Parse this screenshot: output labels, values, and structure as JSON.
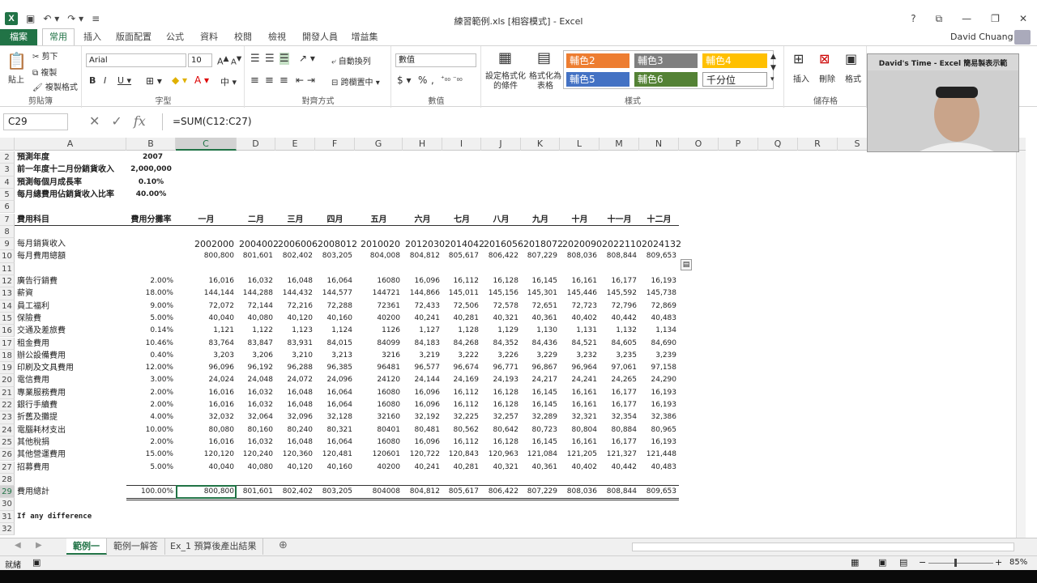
{
  "window": {
    "title": "練習範例.xls  [相容模式] - Excel"
  },
  "ribbon_tabs": [
    {
      "label": "檔案"
    },
    {
      "label": "常用"
    },
    {
      "label": "插入"
    },
    {
      "label": "版面配置"
    },
    {
      "label": "公式"
    },
    {
      "label": "資料"
    },
    {
      "label": "校閱"
    },
    {
      "label": "檢視"
    },
    {
      "label": "開發人員"
    },
    {
      "label": "增益集"
    }
  ],
  "user": {
    "name": "David Chuang"
  },
  "ribbon": {
    "clipboard": {
      "label": "剪貼簿",
      "paste": "貼上",
      "cut": "剪下",
      "copy": "複製",
      "format_painter": "複製格式"
    },
    "font": {
      "label": "字型",
      "name": "Arial",
      "size": "10"
    },
    "alignment": {
      "label": "對齊方式",
      "wrap": "自動換列",
      "merge": "跨欄置中"
    },
    "number": {
      "label": "數值",
      "format": "數值"
    },
    "styles": {
      "label": "樣式",
      "conditional": "設定格式化\n的條件",
      "table": "格式化為\n表格",
      "cells": [
        {
          "label": "輔色2",
          "color": "#ED7D31"
        },
        {
          "label": "輔色3",
          "color": "#7F7F7F"
        },
        {
          "label": "輔色4",
          "color": "#FFC000"
        },
        {
          "label": "輔色5",
          "color": "#4472C4"
        },
        {
          "label": "輔色6",
          "color": "#548235"
        },
        {
          "label": "千分位",
          "color": "#FFFFFF"
        }
      ]
    },
    "cells_group": {
      "label": "儲存格",
      "insert": "插入",
      "delete": "刪除",
      "format": "格式"
    }
  },
  "formula_bar": {
    "name_box": "C29",
    "formula": "=SUM(C12:C27)"
  },
  "webcam": {
    "title": "David's Time - Excel 簡易製表示範"
  },
  "columns": [
    "A",
    "B",
    "C",
    "D",
    "E",
    "F",
    "G",
    "H",
    "I",
    "J",
    "K",
    "L",
    "M",
    "N",
    "O",
    "P",
    "Q",
    "R",
    "S"
  ],
  "selected_column": "C",
  "selected_row": "29",
  "rows": [
    "2",
    "3",
    "4",
    "5",
    "6",
    "7",
    "8",
    "9",
    "10",
    "11",
    "12",
    "13",
    "14",
    "15",
    "16",
    "17",
    "18",
    "19",
    "20",
    "21",
    "22",
    "23",
    "24",
    "25",
    "26",
    "27",
    "28",
    "29",
    "30",
    "31",
    "32"
  ],
  "sheet": {
    "params": [
      {
        "label": "預測年度",
        "value": "2007"
      },
      {
        "label": "前一年度十二月份銷貨收入",
        "value": "2,000,000"
      },
      {
        "label": "預測每個月成長率",
        "value": "0.10%"
      },
      {
        "label": "每月總費用佔銷貨收入比率",
        "value": "40.00%"
      }
    ],
    "header": {
      "item": "費用科目",
      "ratio": "費用分攤率",
      "months": [
        "一月",
        "二月",
        "三月",
        "四月",
        "五月",
        "六月",
        "七月",
        "八月",
        "九月",
        "十月",
        "十一月",
        "十二月"
      ]
    },
    "sales": {
      "label": "每月銷貨收入",
      "values": [
        "2002000",
        "2004002",
        "2006006",
        "2008012",
        "2010020",
        "2012030",
        "2014042",
        "2016056",
        "2018072",
        "2020090",
        "2022110",
        "2024132"
      ]
    },
    "total_expense": {
      "label": "每月費用總額",
      "values": [
        "800,800",
        "801,601",
        "802,402",
        "803,205",
        "804,008",
        "804,812",
        "805,617",
        "806,422",
        "807,229",
        "808,036",
        "808,844",
        "809,653"
      ]
    },
    "expenses": [
      {
        "name": "廣告行銷費",
        "ratio": "2.00%",
        "values": [
          "16,016",
          "16,032",
          "16,048",
          "16,064",
          "16080",
          "16,096",
          "16,112",
          "16,128",
          "16,145",
          "16,161",
          "16,177",
          "16,193"
        ]
      },
      {
        "name": "薪資",
        "ratio": "18.00%",
        "values": [
          "144,144",
          "144,288",
          "144,432",
          "144,577",
          "144721",
          "144,866",
          "145,011",
          "145,156",
          "145,301",
          "145,446",
          "145,592",
          "145,738"
        ]
      },
      {
        "name": "員工福利",
        "ratio": "9.00%",
        "values": [
          "72,072",
          "72,144",
          "72,216",
          "72,288",
          "72361",
          "72,433",
          "72,506",
          "72,578",
          "72,651",
          "72,723",
          "72,796",
          "72,869"
        ]
      },
      {
        "name": "保險費",
        "ratio": "5.00%",
        "values": [
          "40,040",
          "40,080",
          "40,120",
          "40,160",
          "40200",
          "40,241",
          "40,281",
          "40,321",
          "40,361",
          "40,402",
          "40,442",
          "40,483"
        ]
      },
      {
        "name": "交通及差旅費",
        "ratio": "0.14%",
        "values": [
          "1,121",
          "1,122",
          "1,123",
          "1,124",
          "1126",
          "1,127",
          "1,128",
          "1,129",
          "1,130",
          "1,131",
          "1,132",
          "1,134"
        ]
      },
      {
        "name": "租金費用",
        "ratio": "10.46%",
        "values": [
          "83,764",
          "83,847",
          "83,931",
          "84,015",
          "84099",
          "84,183",
          "84,268",
          "84,352",
          "84,436",
          "84,521",
          "84,605",
          "84,690"
        ]
      },
      {
        "name": "辦公設備費用",
        "ratio": "0.40%",
        "values": [
          "3,203",
          "3,206",
          "3,210",
          "3,213",
          "3216",
          "3,219",
          "3,222",
          "3,226",
          "3,229",
          "3,232",
          "3,235",
          "3,239"
        ]
      },
      {
        "name": "印刷及文具費用",
        "ratio": "12.00%",
        "values": [
          "96,096",
          "96,192",
          "96,288",
          "96,385",
          "96481",
          "96,577",
          "96,674",
          "96,771",
          "96,867",
          "96,964",
          "97,061",
          "97,158"
        ]
      },
      {
        "name": "電信費用",
        "ratio": "3.00%",
        "values": [
          "24,024",
          "24,048",
          "24,072",
          "24,096",
          "24120",
          "24,144",
          "24,169",
          "24,193",
          "24,217",
          "24,241",
          "24,265",
          "24,290"
        ]
      },
      {
        "name": "專業服務費用",
        "ratio": "2.00%",
        "values": [
          "16,016",
          "16,032",
          "16,048",
          "16,064",
          "16080",
          "16,096",
          "16,112",
          "16,128",
          "16,145",
          "16,161",
          "16,177",
          "16,193"
        ]
      },
      {
        "name": "銀行手續費",
        "ratio": "2.00%",
        "values": [
          "16,016",
          "16,032",
          "16,048",
          "16,064",
          "16080",
          "16,096",
          "16,112",
          "16,128",
          "16,145",
          "16,161",
          "16,177",
          "16,193"
        ]
      },
      {
        "name": "折舊及攤提",
        "ratio": "4.00%",
        "values": [
          "32,032",
          "32,064",
          "32,096",
          "32,128",
          "32160",
          "32,192",
          "32,225",
          "32,257",
          "32,289",
          "32,321",
          "32,354",
          "32,386"
        ]
      },
      {
        "name": "電腦耗材支出",
        "ratio": "10.00%",
        "values": [
          "80,080",
          "80,160",
          "80,240",
          "80,321",
          "80401",
          "80,481",
          "80,562",
          "80,642",
          "80,723",
          "80,804",
          "80,884",
          "80,965"
        ]
      },
      {
        "name": "其他稅捐",
        "ratio": "2.00%",
        "values": [
          "16,016",
          "16,032",
          "16,048",
          "16,064",
          "16080",
          "16,096",
          "16,112",
          "16,128",
          "16,145",
          "16,161",
          "16,177",
          "16,193"
        ]
      },
      {
        "name": "其他營運費用",
        "ratio": "15.00%",
        "values": [
          "120,120",
          "120,240",
          "120,360",
          "120,481",
          "120601",
          "120,722",
          "120,843",
          "120,963",
          "121,084",
          "121,205",
          "121,327",
          "121,448"
        ]
      },
      {
        "name": "招募費用",
        "ratio": "5.00%",
        "values": [
          "40,040",
          "40,080",
          "40,120",
          "40,160",
          "40200",
          "40,241",
          "40,281",
          "40,321",
          "40,361",
          "40,402",
          "40,442",
          "40,483"
        ]
      }
    ],
    "total": {
      "label": "費用總計",
      "ratio": "100.00%",
      "values": [
        "800,800",
        "801,601",
        "802,402",
        "803,205",
        "804008",
        "804,812",
        "805,617",
        "806,422",
        "807,229",
        "808,036",
        "808,844",
        "809,653"
      ]
    },
    "note": "If any difference"
  },
  "sheet_tabs": [
    {
      "label": "範例一"
    },
    {
      "label": "範例一解答"
    },
    {
      "label": "Ex_1 預算後產出結果"
    }
  ],
  "active_sheet": "範例一",
  "status": {
    "ready": "就緒",
    "zoom": "85%"
  }
}
